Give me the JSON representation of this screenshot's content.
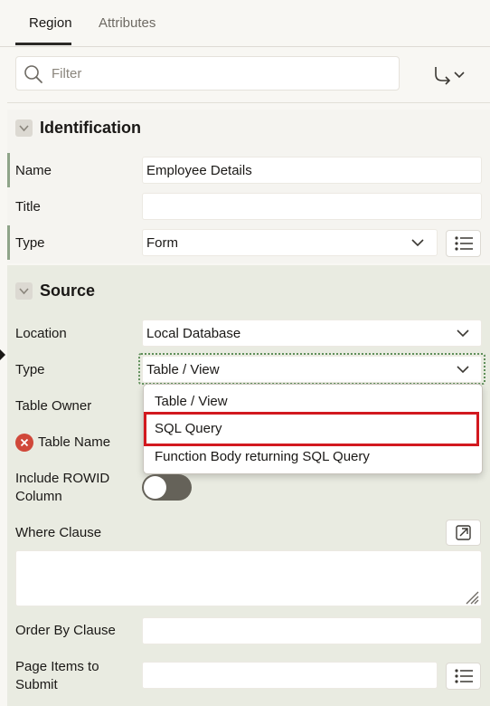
{
  "tabs": [
    {
      "label": "Region",
      "active": true
    },
    {
      "label": "Attributes",
      "active": false
    }
  ],
  "filter": {
    "placeholder": "Filter"
  },
  "identification": {
    "title": "Identification",
    "name_label": "Name",
    "name_value": "Employee Details",
    "title_label": "Title",
    "title_value": "",
    "type_label": "Type",
    "type_value": "Form"
  },
  "source": {
    "title": "Source",
    "location_label": "Location",
    "location_value": "Local Database",
    "type_label": "Type",
    "type_value": "Table / View",
    "table_owner_label": "Table Owner",
    "table_name_label": "Table Name",
    "rowid_label_line1": "Include ROWID",
    "rowid_label_line2": "Column",
    "rowid_enabled": false,
    "where_label": "Where Clause",
    "order_by_label": "Order By Clause",
    "page_items_line1": "Page Items to",
    "page_items_line2": "Submit"
  },
  "type_dropdown": {
    "options": [
      "Table / View",
      "SQL Query",
      "Function Body returning SQL Query"
    ],
    "highlighted": "SQL Query"
  },
  "colors": {
    "required_bar": "#8fa489",
    "highlight_border": "#d2191f",
    "error_icon": "#d0483a",
    "source_bg": "#e9ebe1"
  }
}
